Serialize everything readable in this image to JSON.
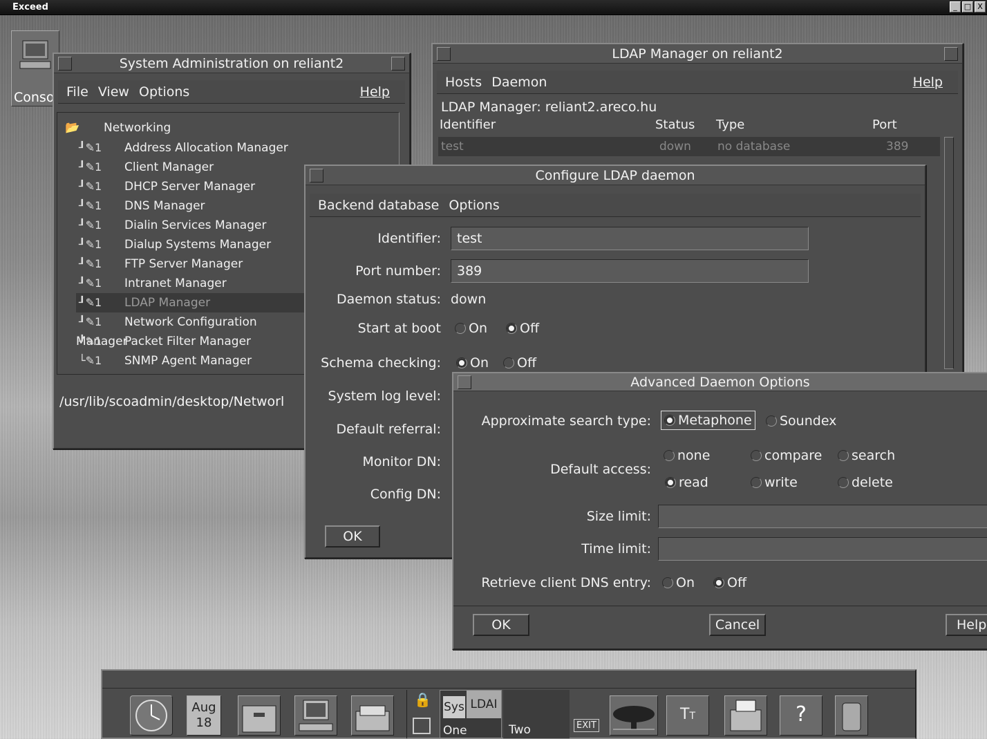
{
  "exceed": {
    "title": "Exceed",
    "buttons": [
      "_",
      "□",
      "X"
    ]
  },
  "console": {
    "label": "Conso"
  },
  "sysadmin": {
    "title": "System Administration on reliant2",
    "menu": {
      "file": "File",
      "view": "View",
      "options": "Options",
      "help": "Help"
    },
    "root": "Networking",
    "items": [
      "Address Allocation Manager",
      "Client Manager",
      "DHCP Server Manager",
      "DNS Manager",
      "Dialin Services Manager",
      "Dialup Systems Manager",
      "FTP Server Manager",
      "Intranet Manager",
      "LDAP Manager",
      "Network Configuration Manager",
      "Packet Filter Manager",
      "SNMP Agent Manager"
    ],
    "item_badge": "1",
    "path": "/usr/lib/scoadmin/desktop/Networl"
  },
  "ldap_manager": {
    "title": "LDAP Manager on reliant2",
    "menu": {
      "hosts": "Hosts",
      "daemon": "Daemon",
      "help": "Help"
    },
    "subtitle": "LDAP Manager: reliant2.areco.hu",
    "columns": {
      "identifier": "Identifier",
      "status": "Status",
      "type": "Type",
      "port": "Port"
    },
    "row": {
      "identifier": "test",
      "status": "down",
      "type": "no database",
      "port": "389"
    }
  },
  "configure": {
    "title": "Configure LDAP daemon",
    "menu": {
      "backend": "Backend database",
      "options": "Options"
    },
    "identifier_label": "Identifier:",
    "identifier_value": "test",
    "port_label": "Port number:",
    "port_value": "389",
    "status_label": "Daemon status:",
    "status_value": "down",
    "boot_label": "Start at boot",
    "boot_on": "On",
    "boot_off": "Off",
    "schema_label": "Schema checking:",
    "schema_on": "On",
    "schema_off": "Off",
    "syslog_label": "System log level:",
    "referral_label": "Default referral:",
    "monitor_label": "Monitor DN:",
    "config_label": "Config DN:",
    "ok": "OK"
  },
  "advanced": {
    "title": "Advanced Daemon Options",
    "search_label": "Approximate search type:",
    "metaphone": "Metaphone",
    "soundex": "Soundex",
    "access_label": "Default access:",
    "access": {
      "none": "none",
      "compare": "compare",
      "search": "search",
      "read": "read",
      "write": "write",
      "delete": "delete"
    },
    "size_label": "Size limit:",
    "time_label": "Time limit:",
    "dns_label": "Retrieve client DNS entry:",
    "dns_on": "On",
    "dns_off": "Off",
    "ok": "OK",
    "cancel": "Cancel",
    "help": "Help"
  },
  "taskbar": {
    "calendar_month": "Aug",
    "calendar_day": "18",
    "ws_one": "One",
    "ws_two": "Two",
    "sys": "Sys",
    "ldap": "LDAI",
    "exit": "EXIT"
  }
}
